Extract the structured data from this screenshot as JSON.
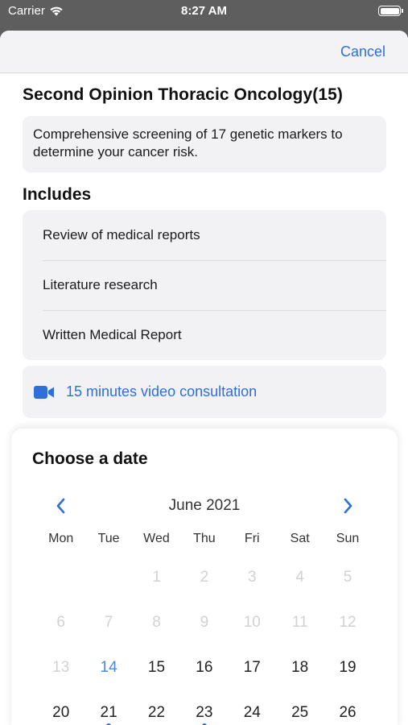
{
  "status": {
    "carrier": "Carrier",
    "time": "8:27 AM"
  },
  "nav": {
    "cancel_label": "Cancel"
  },
  "service": {
    "title": "Second Opinion Thoracic Oncology(15)",
    "description": "Comprehensive screening of 17 genetic markers to determine your cancer risk."
  },
  "includes": {
    "heading": "Includes",
    "items": [
      {
        "label": "Review of medical reports"
      },
      {
        "label": "Literature research"
      },
      {
        "label": "Written Medical Report"
      }
    ]
  },
  "consultation": {
    "label": "15 minutes video consultation",
    "icon": "video-camera-icon"
  },
  "calendar": {
    "heading": "Choose a date",
    "month_label": "June 2021",
    "weekdays": [
      "Mon",
      "Tue",
      "Wed",
      "Thu",
      "Fri",
      "Sat",
      "Sun"
    ],
    "weeks": [
      [
        "",
        "",
        "1",
        "2",
        "3",
        "4",
        "5"
      ],
      [
        "6",
        "7",
        "8",
        "9",
        "10",
        "11",
        "12"
      ],
      [
        "13",
        "14",
        "15",
        "16",
        "17",
        "18",
        "19"
      ],
      [
        "20",
        "21",
        "22",
        "23",
        "24",
        "25",
        "26"
      ]
    ],
    "today": "14",
    "available_dot_days": [
      "21",
      "23"
    ],
    "accent_color": "#2f6fd8"
  }
}
